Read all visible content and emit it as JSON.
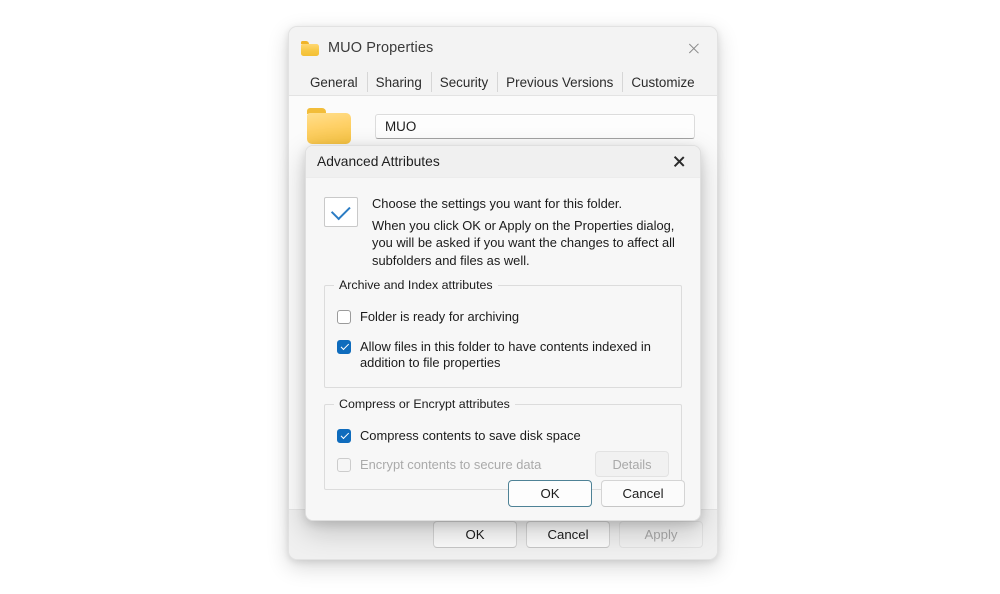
{
  "properties_window": {
    "title": "MUO Properties",
    "folder_icon": "folder-icon",
    "close_icon": "close-icon",
    "tabs": [
      {
        "label": "General",
        "active": true
      },
      {
        "label": "Sharing",
        "active": false
      },
      {
        "label": "Security",
        "active": false
      },
      {
        "label": "Previous Versions",
        "active": false
      },
      {
        "label": "Customize",
        "active": false
      }
    ],
    "general": {
      "folder_icon": "folder-icon",
      "name_value": "MUO"
    },
    "footer": {
      "ok_label": "OK",
      "cancel_label": "Cancel",
      "apply_label": "Apply"
    }
  },
  "advanced_dialog": {
    "title": "Advanced Attributes",
    "close_icon": "close-icon",
    "intro": {
      "icon": "checkbox-preview-icon",
      "line1": "Choose the settings you want for this folder.",
      "line2": "When you click OK or Apply on the Properties dialog, you will be asked if you want the changes to affect all subfolders and files as well."
    },
    "archive_group": {
      "legend": "Archive and Index attributes",
      "items": [
        {
          "label": "Folder is ready for archiving",
          "checked": false,
          "disabled": false
        },
        {
          "label": "Allow files in this folder to have contents indexed in addition to file properties",
          "checked": true,
          "disabled": false
        }
      ]
    },
    "compress_group": {
      "legend": "Compress or Encrypt attributes",
      "items": [
        {
          "label": "Compress contents to save disk space",
          "checked": true,
          "disabled": false
        },
        {
          "label": "Encrypt contents to secure data",
          "checked": false,
          "disabled": true
        }
      ],
      "details_label": "Details",
      "details_disabled": true
    },
    "footer": {
      "ok_label": "OK",
      "cancel_label": "Cancel"
    }
  },
  "colors": {
    "accent_blue": "#0f6cbd",
    "default_button_border": "#4e8296",
    "folder_yellow": "#f7c844",
    "page_background": "#ffffff",
    "window_background": "#f3f3f3",
    "dialog_background": "#f7f7f7",
    "disabled_text": "#aaaaaa"
  }
}
